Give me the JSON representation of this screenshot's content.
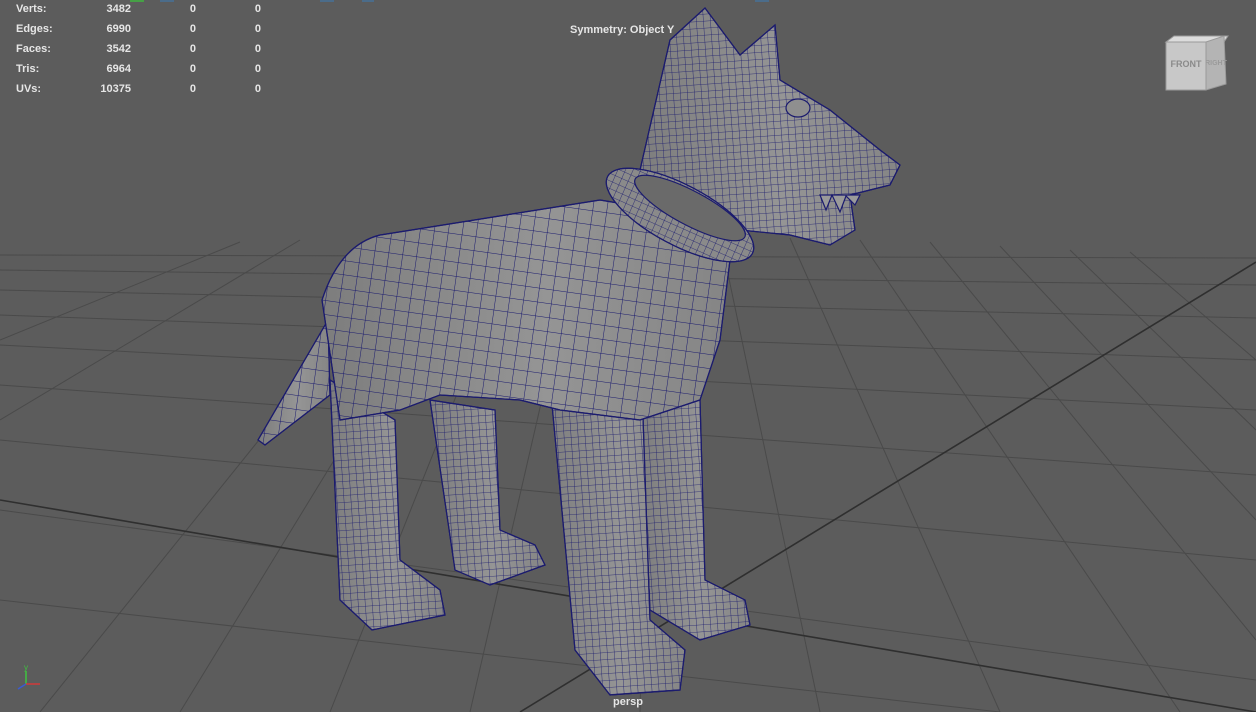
{
  "hud": {
    "rows": [
      {
        "label": "Verts:",
        "v1": "3482",
        "v2": "0",
        "v3": "0"
      },
      {
        "label": "Edges:",
        "v1": "6990",
        "v2": "0",
        "v3": "0"
      },
      {
        "label": "Faces:",
        "v1": "3542",
        "v2": "0",
        "v3": "0"
      },
      {
        "label": "Tris:",
        "v1": "6964",
        "v2": "0",
        "v3": "0"
      },
      {
        "label": "UVs:",
        "v1": "10375",
        "v2": "0",
        "v3": "0"
      }
    ]
  },
  "symmetry_label": "Symmetry: Object Y",
  "camera_label": "persp",
  "viewcube": {
    "front": "FRONT",
    "right": "RIGHT"
  },
  "axis_gizmo": {
    "y_label": "y"
  },
  "colors": {
    "viewport_bg": "#5c5c5c",
    "grid_line": "#4a4a4a",
    "grid_axis": "#2f2f2f",
    "mesh_fill": "#8f8f8f",
    "wireframe": "#1b1b6e",
    "hud_text": "#e6e6e6"
  }
}
